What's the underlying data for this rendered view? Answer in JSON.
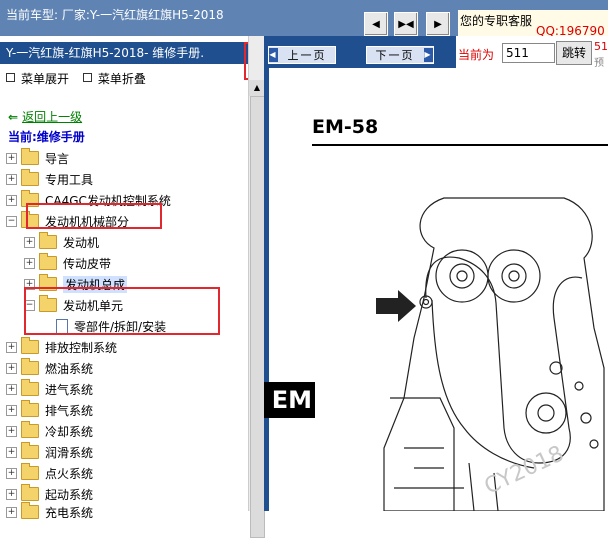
{
  "topbar": {
    "car_info": "当前车型:  厂家:Y-一汽红旗红旗H5-2018",
    "buttons": [
      "prev-icon",
      "fit-icon",
      "next-icon"
    ]
  },
  "service": {
    "label": "您的专职客服",
    "qq": "QQ:196790"
  },
  "left": {
    "manual_title": "Y-一汽红旗-红旗H5-2018- 维修手册.",
    "expand": "菜单展开",
    "collapse": "菜单折叠",
    "back": "返回上一级",
    "current": "当前:维修手册",
    "tree": [
      "导言",
      "专用工具",
      "CA4GC发动机控制系统",
      "发动机机械部分",
      "发动机",
      "传动皮带",
      "发动机总成",
      "发动机单元",
      "零部件/拆卸/安装",
      "排放控制系统",
      "燃油系统",
      "进气系统",
      "排气系统",
      "冷却系统",
      "润滑系统",
      "点火系统",
      "起动系统",
      "充电系统"
    ]
  },
  "nav": {
    "prev": "上一页",
    "next": "下一页"
  },
  "pageinfo": {
    "label": "当前为",
    "page": "511",
    "go": "跳转",
    "hint1": "51",
    "hint2": "预"
  },
  "doc": {
    "page_title": "EM-58",
    "section_tab": "EM",
    "watermark": "CY2018"
  },
  "colors": {
    "topbar": "#5f84b4",
    "panel_blue": "#1f4f8f",
    "highlight_red": "#e0282e",
    "back_green": "#008000"
  }
}
